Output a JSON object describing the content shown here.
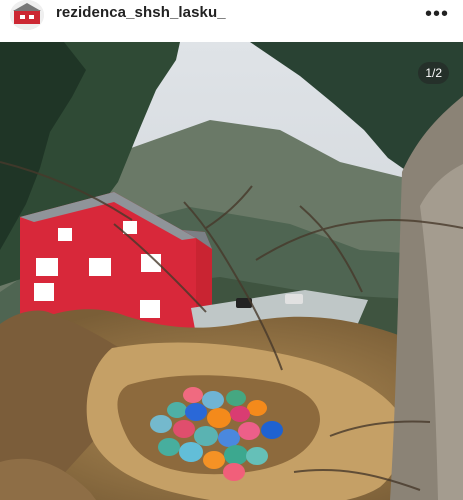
{
  "post": {
    "username": "rezidenca_shsh_lasku_",
    "more_icon": "more-horizontal-icon",
    "avatar_icon": "profile-avatar"
  },
  "carousel": {
    "counter": "1/2"
  },
  "colors": {
    "house_red": "#d8283a",
    "sky": "#d8dde2",
    "mountain": "#6f7f6b",
    "egg_blue": "#2a68d8",
    "egg_orange": "#f48a1b"
  }
}
